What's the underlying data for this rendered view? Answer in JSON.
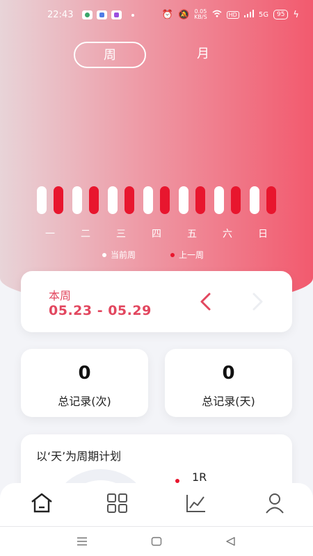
{
  "status_bar": {
    "time": "22:43",
    "net_speed": [
      "0.05",
      "KB/S"
    ],
    "hd_label": "HD",
    "signal_label": "5G",
    "battery": "95"
  },
  "period_tabs": {
    "week": "周",
    "month": "月"
  },
  "chart_data": {
    "type": "bar",
    "categories": [
      "一",
      "二",
      "三",
      "四",
      "五",
      "六",
      "日"
    ],
    "series": [
      {
        "name": "当前周",
        "values": [
          0,
          0,
          0,
          0,
          0,
          0,
          0
        ],
        "color": "#ffffff"
      },
      {
        "name": "上一周",
        "values": [
          0,
          0,
          0,
          0,
          0,
          0,
          0
        ],
        "color": "#e8162e"
      }
    ],
    "legend_position": "bottom-center"
  },
  "week_card": {
    "label": "本周",
    "range": "05.23 - 05.29"
  },
  "stats": [
    {
      "value": "0",
      "label": "总记录(次)"
    },
    {
      "value": "0",
      "label": "总记录(天)"
    }
  ],
  "plan": {
    "title": "以‘天’为周期计划",
    "legend_text": "1R"
  },
  "tabbar": {
    "items": [
      "home-icon",
      "grid-icon",
      "chart-icon",
      "profile-icon"
    ]
  },
  "colors": {
    "accent": "#e2475f",
    "prev_week": "#e8162e",
    "hero_left": "#e8d4d8",
    "hero_right": "#f25a6e"
  }
}
